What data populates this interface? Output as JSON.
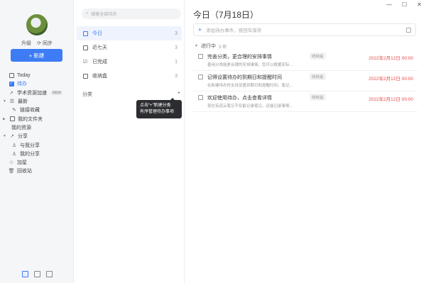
{
  "window": {
    "minimize": "—",
    "maximize": "☐",
    "close": "✕"
  },
  "rail": {
    "upgrade_label": "升级",
    "sync_label": "同步",
    "new_button_label": "+ 新建",
    "items": [
      {
        "label": "Today"
      },
      {
        "label": "待办"
      },
      {
        "label": "学术资源加速",
        "badge": "NEW"
      },
      {
        "label": "最新"
      },
      {
        "label": "链接收藏"
      },
      {
        "label": "我的文件夹"
      },
      {
        "label": "我的资源"
      },
      {
        "label": "分享"
      },
      {
        "label": "与我分享"
      },
      {
        "label": "我的分享"
      },
      {
        "label": "加星"
      },
      {
        "label": "回收站"
      }
    ]
  },
  "mid": {
    "search_placeholder": "搜索全部待办",
    "items": [
      {
        "label": "今日",
        "count": "3"
      },
      {
        "label": "近七天",
        "count": "3"
      },
      {
        "label": "已完成",
        "count": "1"
      },
      {
        "label": "收纳盒",
        "count": "3"
      }
    ],
    "category_label": "分类",
    "category_add": "+",
    "tooltip_line1": "点击“+”新建分类",
    "tooltip_line2": "有序管理待办事项"
  },
  "main": {
    "title": "今日（7月18日）",
    "add_placeholder": "添加待办事件，按回车保存",
    "group_label": "进行中",
    "group_count": "3 项",
    "tasks": [
      {
        "title": "完善分类，更合理的安排事情",
        "desc": "善用分类能更合理的安排事情，您可以根据实际...",
        "tag": "收纳盒",
        "due": "2022年2月12日 00:00"
      },
      {
        "title": "记得设置待办的到期日和提醒时间",
        "desc": "在新建待办时支持设置到期日和提醒时间，笔记...",
        "tag": "收纳盒",
        "due": "2022年2月12日 00:00"
      },
      {
        "title": "欢迎使用待办，点击查看详情",
        "desc": "现在有道云笔记不仅能记录笔记，还能记录事情...",
        "tag": "收纳盒",
        "due": "2022年2月12日 00:00"
      }
    ]
  },
  "colors": {
    "accent": "#3d7cf5",
    "due": "#e84a4a"
  }
}
